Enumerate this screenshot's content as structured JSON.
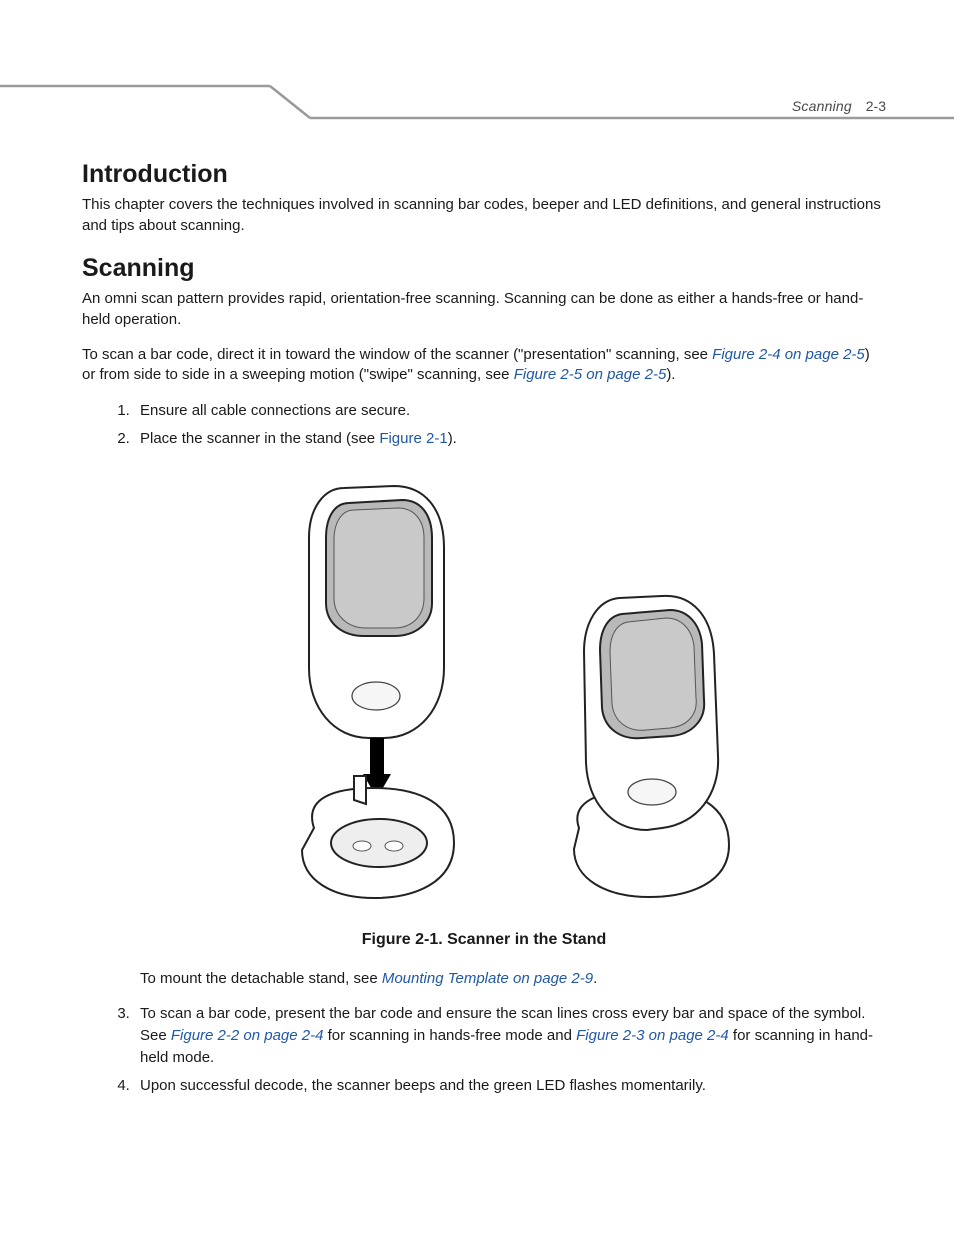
{
  "header": {
    "section": "Scanning",
    "page_number": "2-3"
  },
  "intro": {
    "heading": "Introduction",
    "body": "This chapter covers the techniques involved in scanning bar codes, beeper and LED definitions, and general instructions and tips about scanning."
  },
  "scanning": {
    "heading": "Scanning",
    "para1": "An omni scan pattern provides rapid, orientation-free scanning. Scanning can be done as either a hands-free or hand-held operation.",
    "para2_a": "To scan a bar code, direct it in toward the window of the scanner (\"presentation\" scanning, see ",
    "para2_link1": "Figure 2-4 on page 2-5",
    "para2_b": ") or from side to side in a sweeping motion (\"swipe\" scanning, see ",
    "para2_link2": "Figure 2-5 on page 2-5",
    "para2_c": ").",
    "step1": "Ensure all cable connections are secure.",
    "step2_a": "Place the scanner in the stand (see ",
    "step2_link": "Figure 2-1",
    "step2_b": ").",
    "figure_caption": "Figure 2-1.  Scanner in the Stand",
    "mount_note_a": "To mount the detachable stand, see ",
    "mount_note_link": "Mounting Template on page 2-9",
    "mount_note_b": ".",
    "step3_a": "To scan a bar code, present the bar code and ensure the scan lines cross every bar and space of the symbol. See ",
    "step3_link1": "Figure 2-2 on page 2-4",
    "step3_b": " for scanning in hands-free mode and ",
    "step3_link2": "Figure 2-3 on page 2-4",
    "step3_c": " for scanning in hand-held mode.",
    "step4": "Upon successful decode, the scanner beeps and the green LED flashes momentarily."
  }
}
